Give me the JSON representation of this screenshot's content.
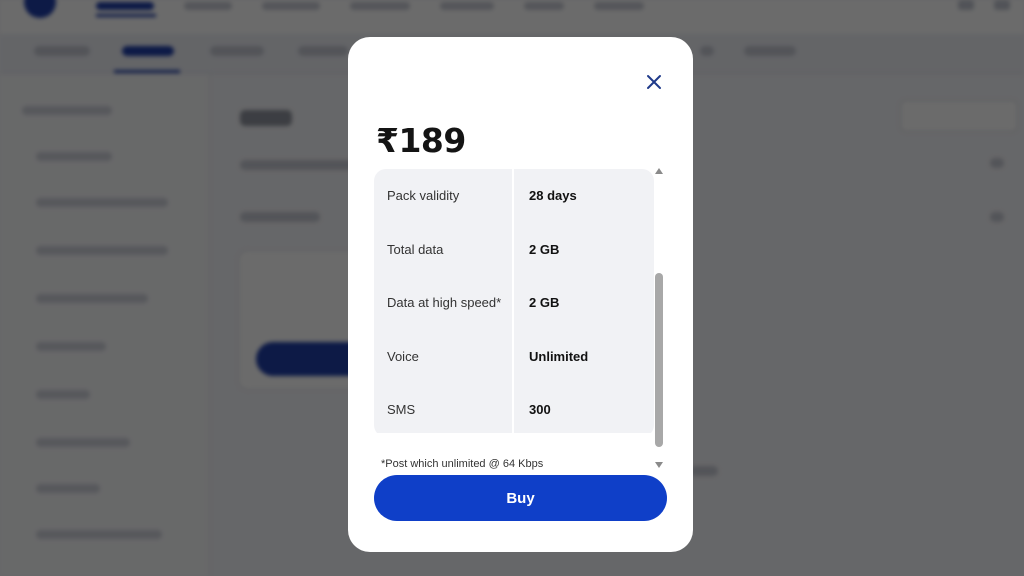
{
  "colors": {
    "accent": "#0f3fc8",
    "overlay": "rgba(0,0,0,0.58)",
    "row_background": "#f1f2f5",
    "price_text": "#141414"
  },
  "modal": {
    "close_icon": "close-icon",
    "price": "₹189",
    "details": [
      {
        "label": "Pack validity",
        "value": "28 days"
      },
      {
        "label": "Total data",
        "value": "2 GB"
      },
      {
        "label": "Data at high speed*",
        "value": "2 GB"
      },
      {
        "label": "Voice",
        "value": "Unlimited"
      },
      {
        "label": "SMS",
        "value": "300"
      }
    ],
    "footnote": "*Post which unlimited @ 64 Kbps",
    "buy_label": "Buy",
    "scroll_icons": {
      "up": "scroll-up-icon",
      "down": "scroll-down-icon"
    }
  }
}
